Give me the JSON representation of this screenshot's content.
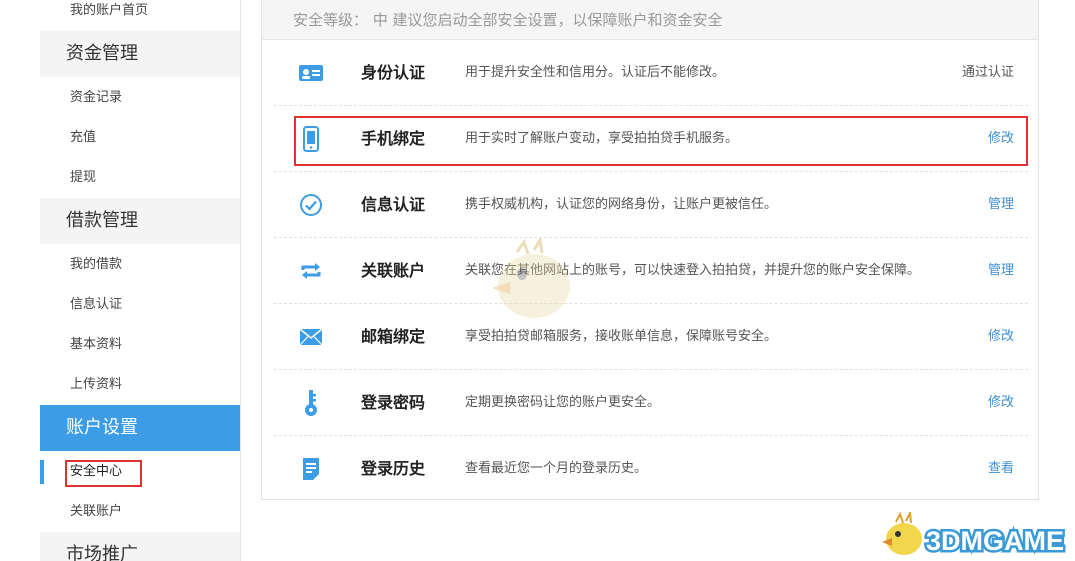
{
  "sidebar": {
    "items_top": [
      "我的账户首页"
    ],
    "groups": [
      {
        "label": "资金管理",
        "items": [
          "资金记录",
          "充值",
          "提现"
        ]
      },
      {
        "label": "借款管理",
        "items": [
          "我的借款",
          "信息认证",
          "基本资料",
          "上传资料"
        ]
      },
      {
        "label": "账户设置",
        "items": [
          "安全中心",
          "关联账户"
        ]
      },
      {
        "label": "市场推广",
        "items": []
      }
    ],
    "active_item": "安全中心"
  },
  "security": {
    "level_text": "安全等级： 中  建议您启动全部安全设置，以保障账户和资金安全",
    "rows": [
      {
        "icon": "id-card-icon",
        "name": "身份认证",
        "desc": "用于提升安全性和信用分。认证后不能修改。",
        "action": "通过认证",
        "action_link": false
      },
      {
        "icon": "mobile-phone-icon",
        "name": "手机绑定",
        "desc": "用于实时了解账户变动，享受拍拍贷手机服务。",
        "action": "修改",
        "action_link": true
      },
      {
        "icon": "check-circle-icon",
        "name": "信息认证",
        "desc": "携手权威机构，认证您的网络身份，让账户更被信任。",
        "action": "管理",
        "action_link": true
      },
      {
        "icon": "sync-arrows-icon",
        "name": "关联账户",
        "desc": "关联您在其他网站上的账号，可以快速登入拍拍贷，并提升您的账户安全保障。",
        "action": "管理",
        "action_link": true
      },
      {
        "icon": "envelope-icon",
        "name": "邮箱绑定",
        "desc": "享受拍拍贷邮箱服务，接收账单信息，保障账号安全。",
        "action": "修改",
        "action_link": true
      },
      {
        "icon": "key-icon",
        "name": "登录密码",
        "desc": "定期更换密码让您的账户更安全。",
        "action": "修改",
        "action_link": true
      },
      {
        "icon": "document-icon",
        "name": "登录历史",
        "desc": "查看最近您一个月的登录历史。",
        "action": "查看",
        "action_link": true
      }
    ]
  },
  "watermark": {
    "text": "3DMGAME"
  },
  "colors": {
    "accent": "#3c9de6",
    "link": "#3c8fd6",
    "highlight": "#e0322e"
  }
}
